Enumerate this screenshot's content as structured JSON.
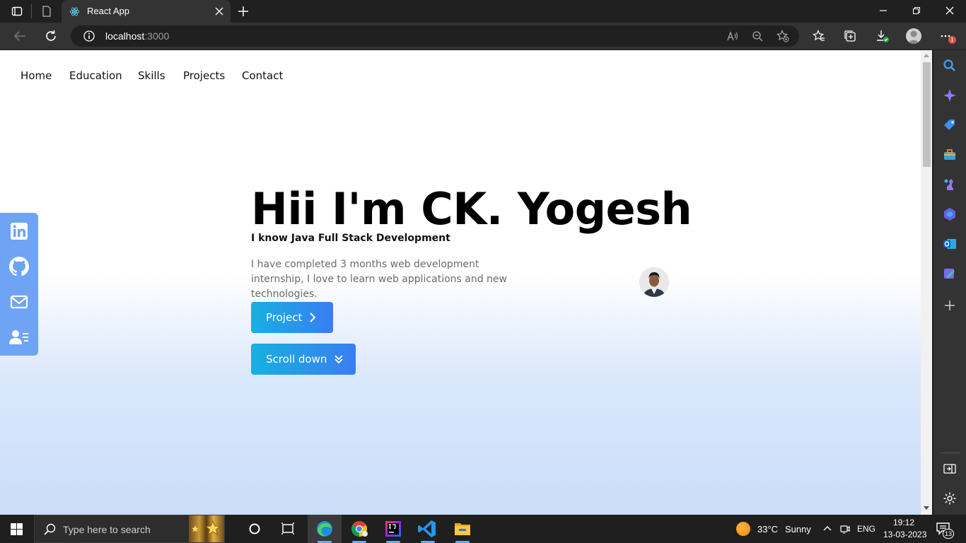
{
  "browser": {
    "tab_title": "React App",
    "url_host": "localhost",
    "url_port": ":3000"
  },
  "nav": {
    "items": [
      "Home",
      "Education",
      "Skills",
      "Projects",
      "Contact"
    ]
  },
  "hero": {
    "title": "Hii I'm CK. Yogesh",
    "subtitle": "I know Java Full Stack Development",
    "description": "I have completed 3 months web development internship, I love to learn web applications and new technologies.",
    "project_button": "Project",
    "scroll_button": "Scroll down"
  },
  "social": {
    "icons": [
      "linkedin-icon",
      "github-icon",
      "mail-icon",
      "contact-card-icon"
    ]
  },
  "taskbar": {
    "search_placeholder": "Type here to search",
    "weather_temp": "33°C",
    "weather_desc": "Sunny",
    "language": "ENG",
    "time": "19:12",
    "date": "13-03-2023",
    "notification_count": "13"
  },
  "edge_badge": "1",
  "colors": {
    "accent_blue": "#3a7df2",
    "accent_cyan": "#18b0e0",
    "social_bg": "#6ea4f3"
  }
}
